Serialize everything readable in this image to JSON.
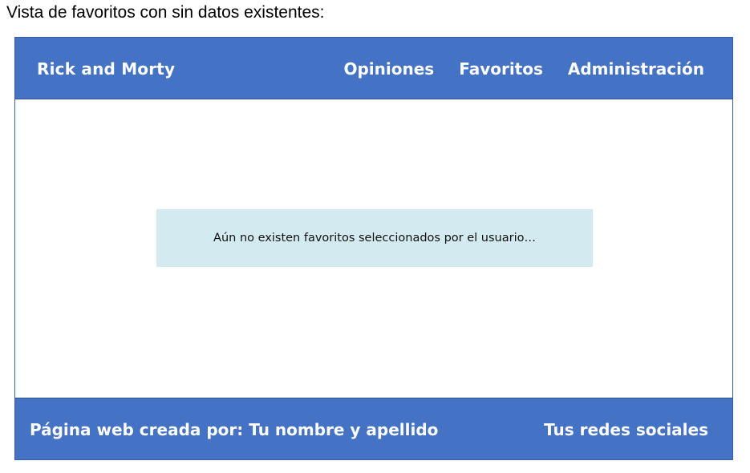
{
  "caption": "Vista de favoritos con sin datos existentes:",
  "header": {
    "brand": "Rick and Morty",
    "nav": [
      {
        "label": "Opiniones"
      },
      {
        "label": "Favoritos"
      },
      {
        "label": "Administración"
      }
    ]
  },
  "main": {
    "empty_message": "Aún no existen favoritos seleccionados por el usuario…"
  },
  "footer": {
    "credit": "Página web creada por: Tu nombre y apellido",
    "social": "Tus redes sociales"
  },
  "colors": {
    "header_bg": "#4472c4",
    "footer_bg": "#4472c4",
    "notice_bg": "#d2eaf0",
    "text_on_accent": "#ffffff"
  }
}
